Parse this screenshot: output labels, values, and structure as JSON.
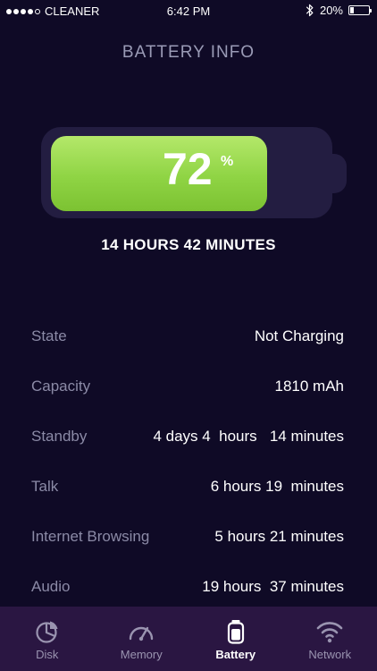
{
  "status_bar": {
    "carrier": "CLEANER",
    "time": "6:42 PM",
    "battery_percent": "20%",
    "signal_bars_filled": 4,
    "signal_bars_total": 5
  },
  "page": {
    "title": "BATTERY INFO"
  },
  "battery": {
    "level_value": "72",
    "level_unit": "%",
    "level_fraction": 0.72,
    "remaining": "14  HOURS   42 MINUTES",
    "fill_color": "#8fd444"
  },
  "info": [
    {
      "label": "State",
      "value": "Not Charging"
    },
    {
      "label": "Capacity",
      "value": "1810 mAh"
    },
    {
      "label": "Standby",
      "value": "4 days 4  hours   14 minutes"
    },
    {
      "label": "Talk",
      "value": "6 hours 19  minutes"
    },
    {
      "label": "Internet Browsing",
      "value": "5 hours 21 minutes"
    },
    {
      "label": "Audio",
      "value": "19 hours  37 minutes"
    }
  ],
  "tabs": [
    {
      "label": "Disk",
      "icon": "disk-icon"
    },
    {
      "label": "Memory",
      "icon": "speedometer-icon"
    },
    {
      "label": "Battery",
      "icon": "battery-icon"
    },
    {
      "label": "Network",
      "icon": "wifi-icon"
    }
  ],
  "active_tab": "Battery",
  "colors": {
    "background": "#0f0a26",
    "tab_bar": "#2a1642",
    "label": "#8b8aa6",
    "battery_shell": "#231d41"
  }
}
